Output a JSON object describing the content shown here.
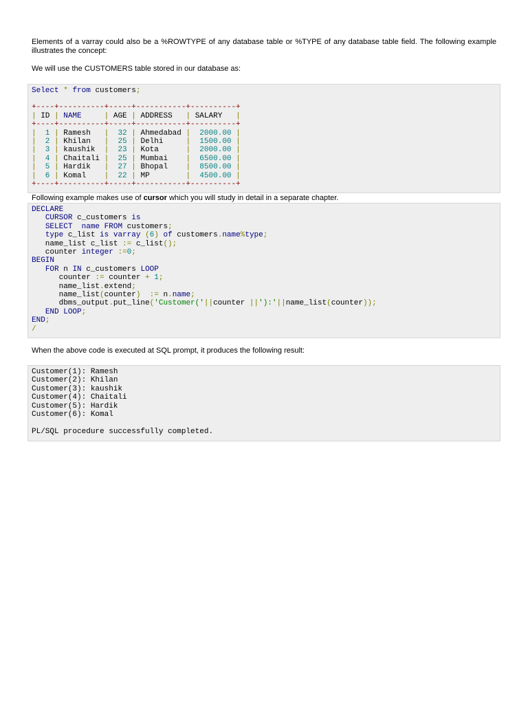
{
  "intro": "Elements of a varray could also be a %ROWTYPE of any database table or %TYPE of any database table field. The following example illustrates the concept:",
  "use_table": "We will use the CUSTOMERS table stored in our database as:",
  "query": [
    [
      "k",
      "Select"
    ],
    [
      "t",
      " "
    ],
    [
      "p",
      "*"
    ],
    [
      "t",
      " "
    ],
    [
      "k",
      "from"
    ],
    [
      "t",
      " customers"
    ],
    [
      "p",
      ";"
    ]
  ],
  "table": {
    "headers": [
      "ID",
      "NAME",
      "AGE",
      "ADDRESS",
      "SALARY"
    ],
    "widths": [
      4,
      10,
      5,
      11,
      10
    ],
    "numeric": [
      true,
      false,
      true,
      false,
      true
    ],
    "rows": [
      [
        "1",
        "Ramesh",
        "32",
        "Ahmedabad",
        "2000.00"
      ],
      [
        "2",
        "Khilan",
        "25",
        "Delhi",
        "1500.00"
      ],
      [
        "3",
        "kaushik",
        "23",
        "Kota",
        "2000.00"
      ],
      [
        "4",
        "Chaitali",
        "25",
        "Mumbai",
        "6500.00"
      ],
      [
        "5",
        "Hardik",
        "27",
        "Bhopal",
        "8500.00"
      ],
      [
        "6",
        "Komal",
        "22",
        "MP",
        "4500.00"
      ]
    ]
  },
  "cursor_note": {
    "before": "Following example makes use of ",
    "bold": "cursor",
    "after": " which you will study in detail in a separate chapter."
  },
  "code": [
    [
      [
        "k",
        "DECLARE"
      ]
    ],
    [
      [
        "t",
        "   "
      ],
      [
        "k",
        "CURSOR"
      ],
      [
        "t",
        " c_customers "
      ],
      [
        "k",
        "is"
      ]
    ],
    [
      [
        "t",
        "   "
      ],
      [
        "k",
        "SELECT"
      ],
      [
        "t",
        "  "
      ],
      [
        "k",
        "name"
      ],
      [
        "t",
        " "
      ],
      [
        "k",
        "FROM"
      ],
      [
        "t",
        " customers"
      ],
      [
        "p",
        ";"
      ]
    ],
    [
      [
        "t",
        "   "
      ],
      [
        "k",
        "type"
      ],
      [
        "t",
        " c_list "
      ],
      [
        "k",
        "is"
      ],
      [
        "t",
        " "
      ],
      [
        "k",
        "varray"
      ],
      [
        "t",
        " "
      ],
      [
        "p",
        "("
      ],
      [
        "n",
        "6"
      ],
      [
        "p",
        ")"
      ],
      [
        "t",
        " "
      ],
      [
        "k",
        "of"
      ],
      [
        "t",
        " customers"
      ],
      [
        "p",
        "."
      ],
      [
        "k",
        "name"
      ],
      [
        "p",
        "%"
      ],
      [
        "k",
        "type"
      ],
      [
        "p",
        ";"
      ]
    ],
    [
      [
        "t",
        "   name_list c_list "
      ],
      [
        "p",
        ":="
      ],
      [
        "t",
        " c_list"
      ],
      [
        "p",
        "();"
      ]
    ],
    [
      [
        "t",
        "   counter "
      ],
      [
        "k",
        "integer"
      ],
      [
        "t",
        " "
      ],
      [
        "p",
        ":="
      ],
      [
        "n",
        "0"
      ],
      [
        "p",
        ";"
      ]
    ],
    [
      [
        "k",
        "BEGIN"
      ]
    ],
    [
      [
        "t",
        "   "
      ],
      [
        "k",
        "FOR"
      ],
      [
        "t",
        " n "
      ],
      [
        "k",
        "IN"
      ],
      [
        "t",
        " c_customers "
      ],
      [
        "k",
        "LOOP"
      ]
    ],
    [
      [
        "t",
        "      counter "
      ],
      [
        "p",
        ":="
      ],
      [
        "t",
        " counter "
      ],
      [
        "p",
        "+"
      ],
      [
        "t",
        " "
      ],
      [
        "n",
        "1"
      ],
      [
        "p",
        ";"
      ]
    ],
    [
      [
        "t",
        "      name_list"
      ],
      [
        "p",
        "."
      ],
      [
        "t",
        "extend"
      ],
      [
        "p",
        ";"
      ]
    ],
    [
      [
        "t",
        "      name_list"
      ],
      [
        "p",
        "("
      ],
      [
        "t",
        "counter"
      ],
      [
        "p",
        ")"
      ],
      [
        "t",
        "  "
      ],
      [
        "p",
        ":="
      ],
      [
        "t",
        " n"
      ],
      [
        "p",
        "."
      ],
      [
        "k",
        "name"
      ],
      [
        "p",
        ";"
      ]
    ],
    [
      [
        "t",
        "      dbms_output"
      ],
      [
        "p",
        "."
      ],
      [
        "t",
        "put_line"
      ],
      [
        "p",
        "("
      ],
      [
        "s",
        "'Customer('"
      ],
      [
        "p",
        "||"
      ],
      [
        "t",
        "counter "
      ],
      [
        "p",
        "||"
      ],
      [
        "s",
        "'):'"
      ],
      [
        "p",
        "||"
      ],
      [
        "t",
        "name_list"
      ],
      [
        "p",
        "("
      ],
      [
        "t",
        "counter"
      ],
      [
        "p",
        "));"
      ]
    ],
    [
      [
        "t",
        "   "
      ],
      [
        "k",
        "END"
      ],
      [
        "t",
        " "
      ],
      [
        "k",
        "LOOP"
      ],
      [
        "p",
        ";"
      ]
    ],
    [
      [
        "k",
        "END"
      ],
      [
        "p",
        ";"
      ]
    ],
    [
      [
        "p",
        "/"
      ]
    ]
  ],
  "result_note": "When the above code is executed at SQL prompt, it produces the following result:",
  "output": [
    "Customer(1): Ramesh",
    "Customer(2): Khilan",
    "Customer(3): kaushik",
    "Customer(4): Chaitali",
    "Customer(5): Hardik",
    "Customer(6): Komal",
    "",
    "PL/SQL procedure successfully completed."
  ]
}
